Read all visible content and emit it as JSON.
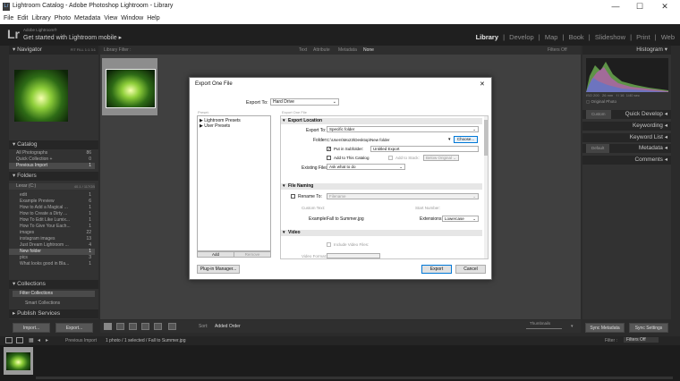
{
  "window": {
    "title": "Lightroom Catalog - Adobe Photoshop Lightroom - Library",
    "app_icon": "Lr",
    "controls": [
      "—",
      "☐",
      "✕"
    ]
  },
  "menu": [
    "File",
    "Edit",
    "Library",
    "Photo",
    "Metadata",
    "View",
    "Window",
    "Help"
  ],
  "identity": {
    "logo": "Lr",
    "subtitle": "Adobe Lightroom®",
    "main": "Get started with Lightroom mobile ▸"
  },
  "modules": [
    {
      "label": "Library",
      "active": true
    },
    {
      "label": "|"
    },
    {
      "label": "Develop"
    },
    {
      "label": "|"
    },
    {
      "label": "Map"
    },
    {
      "label": "|"
    },
    {
      "label": "Book"
    },
    {
      "label": "|"
    },
    {
      "label": "Slideshow"
    },
    {
      "label": "|"
    },
    {
      "label": "Print"
    },
    {
      "label": "|"
    },
    {
      "label": "Web"
    }
  ],
  "left_panel": {
    "navigator": {
      "title": "Navigator",
      "zoom_options": [
        "FIT",
        "FILL",
        "1:1",
        "3:1"
      ]
    },
    "catalog": {
      "title": "Catalog",
      "items": [
        {
          "label": "All Photographs",
          "count": "86"
        },
        {
          "label": "Quick Collection +",
          "count": "0"
        },
        {
          "label": "Previous Import",
          "count": "1"
        }
      ]
    },
    "folders": {
      "title": "Folders",
      "volume": "Lexar (C:)",
      "volume_info": "40.1 / 117GB",
      "items": [
        {
          "label": "edit",
          "count": "1"
        },
        {
          "label": "Example Preview",
          "count": "6"
        },
        {
          "label": "How to Add a Magical ...",
          "count": "1"
        },
        {
          "label": "How to Create a Dirty ...",
          "count": "1"
        },
        {
          "label": "How To Edit Like Lumix...",
          "count": "1"
        },
        {
          "label": "How To Give Your Each...",
          "count": "1"
        },
        {
          "label": "images",
          "count": "22"
        },
        {
          "label": "instagram images",
          "count": "13"
        },
        {
          "label": "Just Dream Lightroom ...",
          "count": "4"
        },
        {
          "label": "New folder",
          "count": "1"
        },
        {
          "label": "pics",
          "count": "3"
        },
        {
          "label": "What looks good in Bla...",
          "count": "1"
        }
      ]
    },
    "collections": {
      "title": "Collections",
      "items": [
        {
          "label": "Filter Collections"
        },
        {
          "label": "Smart Collections"
        }
      ]
    },
    "publish": {
      "title": "Publish Services"
    },
    "buttons": {
      "import": "Import...",
      "export": "Export..."
    }
  },
  "library_filter": {
    "label": "Library Filter :",
    "options": [
      "Text",
      "Attribute",
      "Metadata",
      "None"
    ],
    "preset": "Filters Off"
  },
  "right_panel": {
    "histogram": {
      "title": "Histogram",
      "meta": [
        "ISO 200",
        "26 mm",
        "f / 16",
        "1/40 sec"
      ],
      "original": "Original Photo"
    },
    "quick_develop": {
      "preset": "Custom",
      "title": "Quick Develop"
    },
    "keywording": {
      "title": "Keywording"
    },
    "keyword_list": {
      "title": "Keyword List"
    },
    "metadata": {
      "preset": "Default",
      "title": "Metadata"
    },
    "comments": {
      "title": "Comments"
    },
    "buttons": {
      "sync_metadata": "Sync Metadata",
      "sync_settings": "Sync Settings"
    }
  },
  "toolbar": {
    "sort_label": "Sort:",
    "sort_value": "Added Order",
    "thumbnails": "Thumbnails"
  },
  "filmstrip": {
    "pages": [
      "1",
      "2"
    ],
    "source": "Previous Import",
    "info": "1 photo / 1 selected / Fall to Summer.jpg",
    "filter_label": "Filter :",
    "filter_value": "Filters Off"
  },
  "dialog": {
    "title": "Export One File",
    "close": "✕",
    "export_to_label": "Export To:",
    "export_to_value": "Hard Drive",
    "preset_label": "Preset:",
    "preset_items": [
      "Lightroom Presets",
      "User Presets"
    ],
    "add_button": "Add",
    "remove_button": "Remove",
    "export_one_file": "Export One File",
    "location": {
      "title": "Export Location",
      "export_to_label": "Export To:",
      "export_to_value": "Specific folder",
      "folder_label": "Folder:",
      "folder_value": "C:\\Users\\Mo23\\Desktop\\New folder",
      "choose_button": "Choose...",
      "subfolder_label": "Put in Subfolder:",
      "subfolder_value": "Untitled Export",
      "add_catalog_label": "Add to This Catalog",
      "add_stack_label": "Add to Stack:",
      "stack_value": "Below Original",
      "existing_label": "Existing Files:",
      "existing_value": "Ask what to do"
    },
    "naming": {
      "title": "File Naming",
      "rename_label": "Rename To:",
      "rename_value": "Filename",
      "custom_text_label": "Custom Text:",
      "start_number_label": "Start Number:",
      "example_label": "Example:",
      "example_value": "Fall to Summer.jpg",
      "extensions_label": "Extensions:",
      "extensions_value": "Lowercase"
    },
    "video": {
      "title": "Video",
      "include_label": "Include Video Files:",
      "format_label": "Video Format:"
    },
    "plugin_button": "Plug-in Manager...",
    "export_button": "Export",
    "cancel_button": "Cancel"
  }
}
